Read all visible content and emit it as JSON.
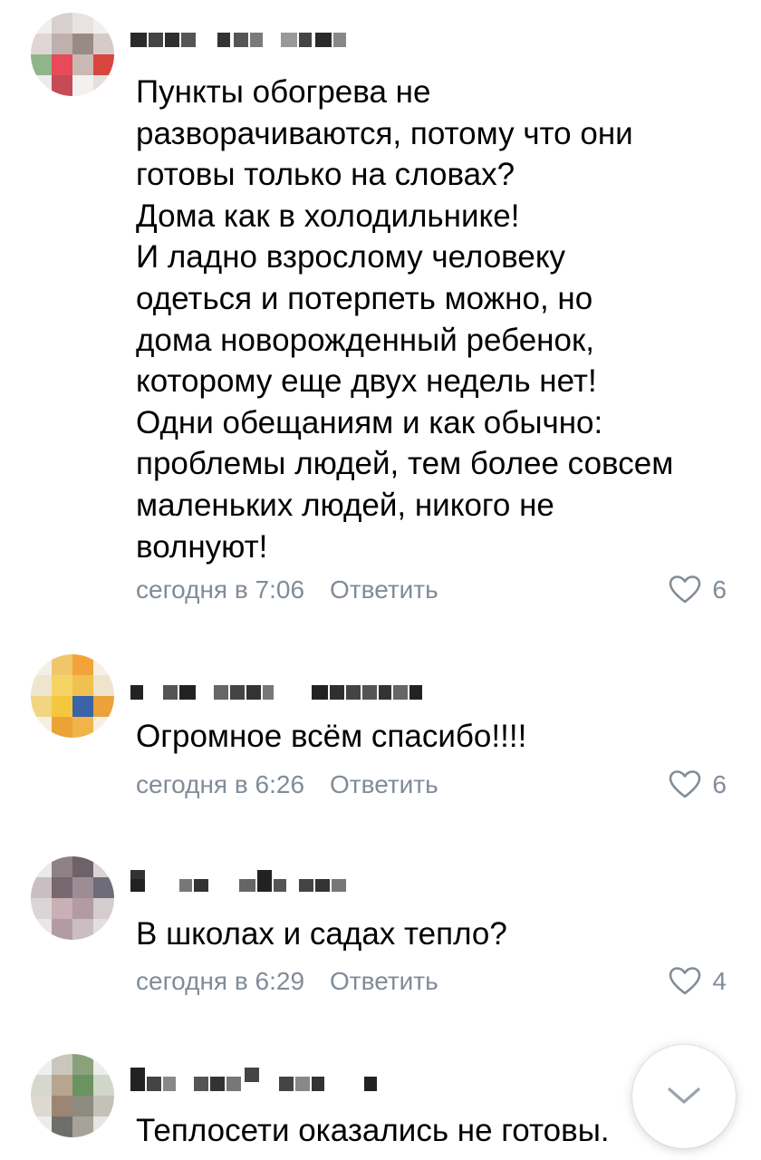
{
  "comments": [
    {
      "author": "",
      "text": "Пункты обогрева не\nразворачиваются, потому что они\nготовы только на словах?\nДома как в холодильнике!\nИ ладно взрослому человеку\nодеться и потерпеть можно, но\nдома новорожденный ребенок,\nкоторому еще двух недель нет!\nОдни обещаниям и как обычно:\nпроблемы людей, тем более совсем\nмаленьких людей, никого не\nволнуют!",
      "time": "сегодня в 7:06",
      "reply_label": "Ответить",
      "likes": "6"
    },
    {
      "author": "",
      "text": "Огромное всём спасибо!!!!",
      "time": "сегодня в 6:26",
      "reply_label": "Ответить",
      "likes": "6"
    },
    {
      "author": "",
      "text": "В школах и садах тепло?",
      "time": "сегодня в 6:29",
      "reply_label": "Ответить",
      "likes": "4"
    },
    {
      "author": "",
      "text": "Теплосети оказались не готовы.",
      "time": "",
      "reply_label": "",
      "likes": ""
    }
  ],
  "icons": {
    "like": "heart-outline-icon",
    "scroll": "chevron-down-icon"
  },
  "colors": {
    "text": "#000000",
    "meta": "#818c99",
    "background": "#ffffff"
  }
}
